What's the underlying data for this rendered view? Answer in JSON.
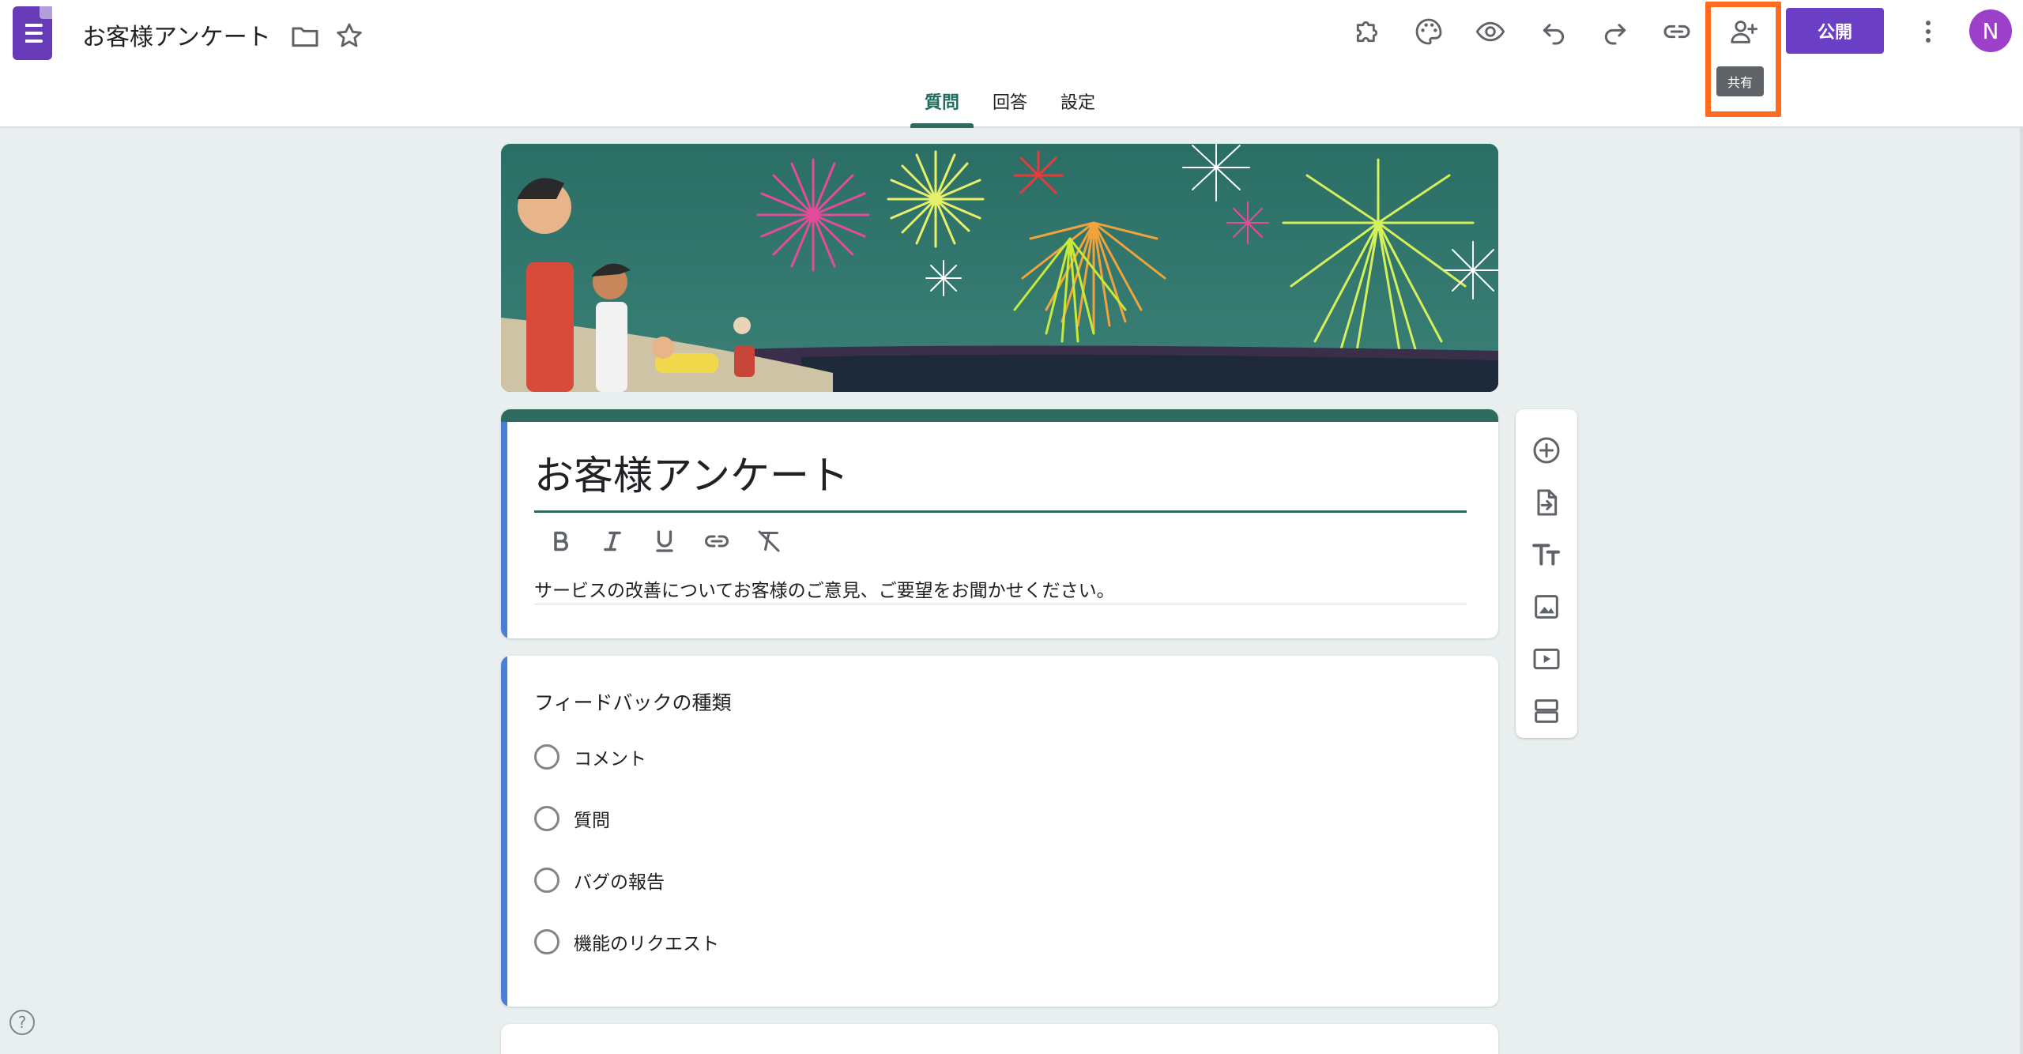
{
  "app": {
    "doc_title": "お客様アンケート",
    "publish_label": "公開",
    "avatar_letter": "N",
    "share_tooltip": "共有"
  },
  "header_icons": {
    "folder": "folder-icon",
    "star": "star-icon",
    "addons": "puzzle-icon",
    "theme": "palette-icon",
    "preview": "eye-icon",
    "undo": "undo-icon",
    "redo": "redo-icon",
    "link": "link-icon",
    "share": "person-add-icon",
    "more": "more-vert-icon"
  },
  "tabs": [
    {
      "label": "質問",
      "active": true
    },
    {
      "label": "回答",
      "active": false
    },
    {
      "label": "設定",
      "active": false
    }
  ],
  "form": {
    "title": "お客様アンケート",
    "description": "サービスの改善についてお客様のご意見、ご要望をお聞かせください。",
    "format_tools": [
      "bold-icon",
      "italic-icon",
      "underline-icon",
      "link-icon",
      "clear-format-icon"
    ]
  },
  "question": {
    "title": "フィードバックの種類",
    "options": [
      "コメント",
      "質問",
      "バグの報告",
      "機能のリクエスト"
    ]
  },
  "side_toolbar": [
    "add-question-icon",
    "import-questions-icon",
    "add-title-icon",
    "add-image-icon",
    "add-video-icon",
    "add-section-icon"
  ],
  "help_label": "?",
  "colors": {
    "accent": "#2e6b5e",
    "publish": "#6b3fc5",
    "background": "#e9efef",
    "card_left_accent": "#4a7fd6",
    "highlight": "#ff6a1f"
  }
}
